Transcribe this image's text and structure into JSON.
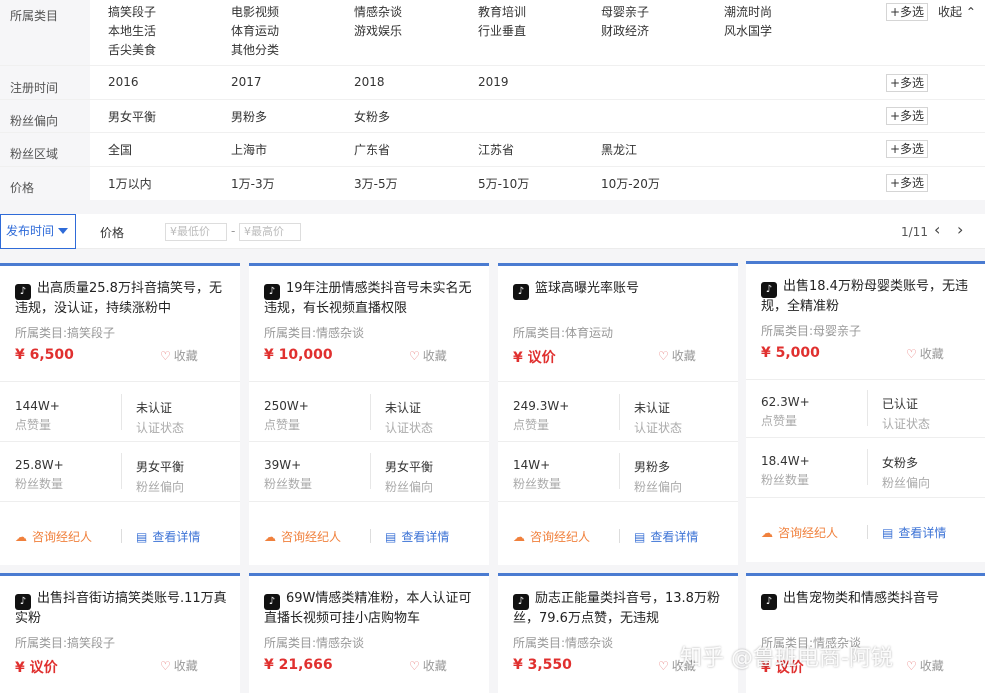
{
  "filters": {
    "category": {
      "label": "所属类目",
      "options": [
        "搞笑段子",
        "电影视频",
        "情感杂谈",
        "教育培训",
        "母婴亲子",
        "潮流时尚",
        "本地生活",
        "体育运动",
        "游戏娱乐",
        "行业垂直",
        "财政经济",
        "风水国学",
        "舌尖美食",
        "其他分类"
      ]
    },
    "register_time": {
      "label": "注册时间",
      "options": [
        "2016",
        "2017",
        "2018",
        "2019"
      ]
    },
    "fan_bias": {
      "label": "粉丝偏向",
      "options": [
        "男女平衡",
        "男粉多",
        "女粉多"
      ]
    },
    "fan_region": {
      "label": "粉丝区域",
      "options": [
        "全国",
        "上海市",
        "广东省",
        "江苏省",
        "黑龙江"
      ]
    },
    "price": {
      "label": "价格",
      "options": [
        "1万以内",
        "1万-3万",
        "3万-5万",
        "5万-10万",
        "10万-20万"
      ]
    },
    "more_label": "+多选",
    "collapse_label": "收起",
    "collapse_icon": "chevron-up-icon"
  },
  "sortbar": {
    "active_sort": "发布时间",
    "price_label": "价格",
    "min_placeholder": "¥最低价",
    "max_placeholder": "¥最高价",
    "dash": "-",
    "pager": "1/11",
    "prev_icon": "‹",
    "next_icon": "›"
  },
  "labels": {
    "likes": "点赞量",
    "auth": "认证状态",
    "fans": "粉丝数量",
    "bias": "粉丝偏向",
    "fav": "收藏",
    "consult": "咨询经纪人",
    "detail": "查看详情",
    "tiktok_icon": "♪",
    "heart_icon": "♡",
    "consult_icon": "☁",
    "detail_icon": "▤"
  },
  "accent_color": "#4a7bd1",
  "price_color": "#e0302f",
  "cards": [
    {
      "title": "出高质量25.8万抖音搞笑号，无违规，没认证，持续涨粉中",
      "category": "所属类目:搞笑段子",
      "price": "¥ 6,500",
      "likes": "144W+",
      "auth": "未认证",
      "fans": "25.8W+",
      "bias": "男女平衡"
    },
    {
      "title": "19年注册情感类抖音号未实名无违规，有长视频直播权限",
      "category": "所属类目:情感杂谈",
      "price": "¥ 10,000",
      "likes": "250W+",
      "auth": "未认证",
      "fans": "39W+",
      "bias": "男女平衡"
    },
    {
      "title": "篮球高曝光率账号",
      "category": "所属类目:体育运动",
      "price": "¥ 议价",
      "likes": "249.3W+",
      "auth": "未认证",
      "fans": "14W+",
      "bias": "男粉多"
    },
    {
      "title": "出售18.4万粉母婴类账号，无违规，全精准粉",
      "category": "所属类目:母婴亲子",
      "price": "¥ 5,000",
      "likes": "62.3W+",
      "auth": "已认证",
      "fans": "18.4W+",
      "bias": "女粉多"
    },
    {
      "title": "出售抖音街访搞笑类账号.11万真实粉",
      "category": "所属类目:搞笑段子",
      "price": "¥ 议价"
    },
    {
      "title": "69W情感类精准粉，本人认证可直播长视频可挂小店购物车",
      "category": "所属类目:情感杂谈",
      "price": "¥ 21,666"
    },
    {
      "title": "励志正能量类抖音号，13.8万粉丝，79.6万点赞，无违规",
      "category": "所属类目:情感杂谈",
      "price": "¥ 3,550"
    },
    {
      "title": "出售宠物类和情感类抖音号",
      "category": "所属类目:情感杂谈",
      "price": "¥ 议价"
    }
  ],
  "watermark": "知乎 @鲁班电商-阿锐"
}
